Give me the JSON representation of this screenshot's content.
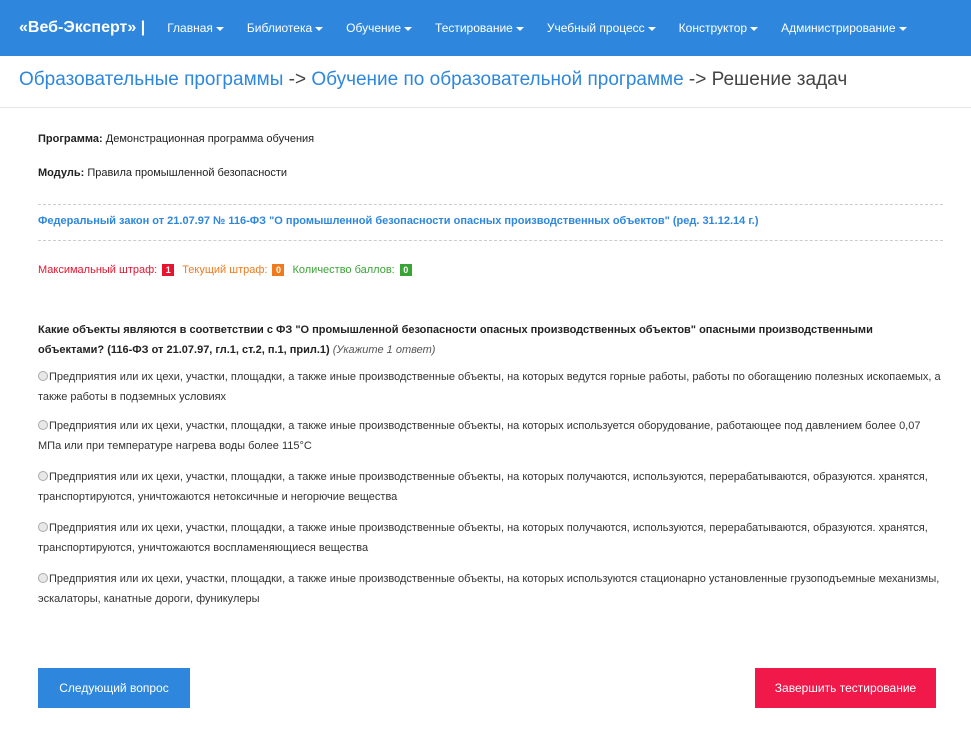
{
  "navbar": {
    "brand": "«Веб-Эксперт» |",
    "items": [
      {
        "label": "Главная"
      },
      {
        "label": "Библиотека"
      },
      {
        "label": "Обучение"
      },
      {
        "label": "Тестирование"
      },
      {
        "label": "Учебный процесс"
      },
      {
        "label": "Конструктор"
      },
      {
        "label": "Администрирование"
      }
    ]
  },
  "breadcrumb": {
    "items": [
      "Образовательные программы",
      "Обучение по образовательной программе"
    ],
    "separator": " -> ",
    "current": "Решение задач"
  },
  "info": {
    "program_label": "Программа:",
    "program_value": "Демонстрационная программа обучения",
    "module_label": "Модуль:",
    "module_value": "Правила промышленной безопасности"
  },
  "law_link": "Федеральный закон от 21.07.97 № 116-ФЗ \"О промышленной безопасности опасных производственных объектов\" (ред. 31.12.14 г.)",
  "scores": {
    "max_penalty_label": "Максимальный штраф:",
    "max_penalty_value": "1",
    "max_penalty_color": "#e8132e",
    "current_penalty_label": "Текущий штраф:",
    "current_penalty_value": "0",
    "current_penalty_color": "#f07b1e",
    "points_label": "Количество баллов:",
    "points_value": "0",
    "points_color": "#3aa335"
  },
  "question": {
    "text": "Какие объекты являются в соответствии с ФЗ \"О промышленной безопасности опасных производственных объектов\" опасными производственными объектами? (116-ФЗ от 21.07.97, гл.1, ст.2, п.1, прил.1)",
    "hint": "(Укажите 1 ответ)"
  },
  "options": [
    {
      "text": "Предприятия или их цехи, участки, площадки, а также иные производственные объекты, на которых ведутся горные работы, работы по обогащению полезных ископаемых, а также работы в подземных условиях",
      "selected": false
    },
    {
      "text": "Предприятия или их цехи, участки, площадки, а также иные производственные объекты, на которых используется оборудование, работающее под давлением более 0,07 МПа или при температуре нагрева воды более 115°С",
      "selected": false
    },
    {
      "text": "Предприятия или их цехи, участки, площадки, а также иные производственные объекты, на которых получаются, используются, перерабатываются, образуются. хранятся, транспортируются, уничтожаются нетоксичные и негорючие вещества",
      "selected": false
    },
    {
      "text": "Предприятия или их цехи, участки, площадки, а также иные производственные объекты, на которых получаются, используются, перерабатываются, образуются. хранятся, транспортируются, уничтожаются воспламеняющиеся вещества",
      "selected": false
    },
    {
      "text": "Предприятия или их цехи, участки, площадки, а также иные производственные объекты, на которых используются стационарно установленные грузоподъемные механизмы, эскалаторы, канатные дороги, фуникулеры",
      "selected": false
    }
  ],
  "buttons": {
    "next_label": "Следующий вопрос",
    "finish_label": "Завершить тестирование"
  },
  "colors": {
    "accent": "#2e87dc",
    "danger": "#f0194a"
  }
}
